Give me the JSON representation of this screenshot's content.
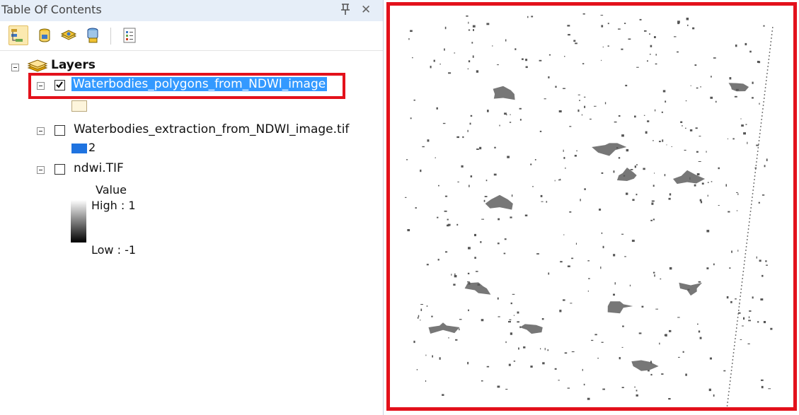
{
  "toc": {
    "title": "Table Of Contents",
    "pin_icon": "pin-icon",
    "close_glyph": "✕",
    "toolbar": [
      {
        "name": "list-by-drawing-order-icon",
        "active": true
      },
      {
        "name": "list-by-source-icon",
        "active": false
      },
      {
        "name": "list-by-visibility-icon",
        "active": false
      },
      {
        "name": "list-by-selection-icon",
        "active": false
      },
      {
        "name": "options-icon",
        "active": false
      }
    ],
    "root": {
      "label": "Layers",
      "icon": "layers-icon"
    },
    "layers": [
      {
        "label": "Waterbodies_polygons_from_NDWI_image",
        "checked": true,
        "selected": true,
        "swatch_color": "#fdf5dc"
      },
      {
        "label": "Waterbodies_extraction_from_NDWI_image.tif",
        "checked": false,
        "legend_value": "2",
        "swatch_color": "#1f73e0"
      },
      {
        "label": "ndwi.TIF",
        "checked": false,
        "legend_title": "Value",
        "legend_high": "High : 1",
        "legend_low": "Low : -1"
      }
    ]
  },
  "colors": {
    "highlight": "#e3111b",
    "selection": "#3399ff",
    "water_features": "#555555"
  }
}
